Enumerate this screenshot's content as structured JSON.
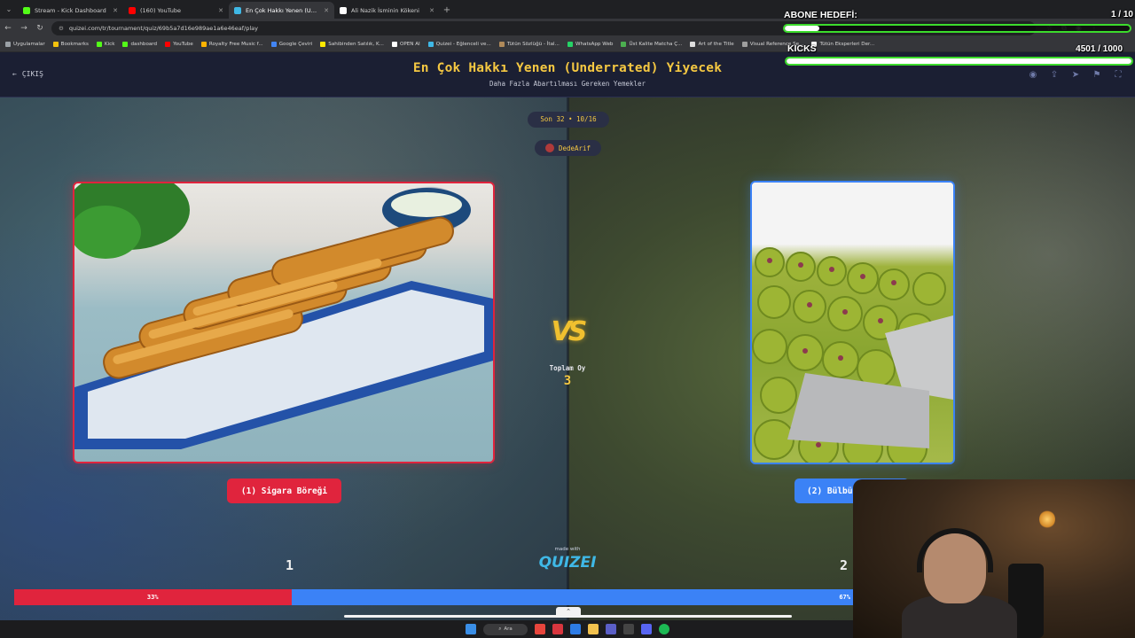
{
  "browser": {
    "tabs": [
      {
        "title": "Stream - Kick Dashboard",
        "favicon_color": "#53fc18",
        "active": false
      },
      {
        "title": "(160) YouTube",
        "favicon_color": "#ff0000",
        "active": false
      },
      {
        "title": "En Çok Hakkı Yenen (Underrated)",
        "favicon_color": "#3fb8e6",
        "active": true
      },
      {
        "title": "Ali Nazik İsminin Kökeni",
        "favicon_color": "#ffffff",
        "active": false
      }
    ],
    "url": "quizei.com/tr/tournament/quiz/69b5a7d16e989ae1a6e46eaf/play",
    "bookmarks": [
      {
        "label": "Uygulamalar",
        "color": "#9aa0a6"
      },
      {
        "label": "Bookmarks",
        "color": "#f4c20d"
      },
      {
        "label": "Kick",
        "color": "#53fc18"
      },
      {
        "label": "dashboard",
        "color": "#53fc18"
      },
      {
        "label": "YouTube",
        "color": "#ff0000"
      },
      {
        "label": "Royalty Free Music f...",
        "color": "#ffb300"
      },
      {
        "label": "Google Çeviri",
        "color": "#4285f4"
      },
      {
        "label": "Sahibinden Satılık, K...",
        "color": "#ffe800"
      },
      {
        "label": "OPEN AI",
        "color": "#ffffff"
      },
      {
        "label": "Quizei - Eğlenceli ve...",
        "color": "#3fb8e6"
      },
      {
        "label": "Tütün Sözlüğü - İtal...",
        "color": "#b08a5a"
      },
      {
        "label": "WhatsApp Web",
        "color": "#25d366"
      },
      {
        "label": "Üst Kalite Matcha Ç...",
        "color": "#4caf50"
      },
      {
        "label": "Art of the Title",
        "color": "#dddddd"
      },
      {
        "label": "Visual Reference Se...",
        "color": "#9e9e9e"
      },
      {
        "label": "Tütün Eksperleri Der...",
        "color": "#ffffff"
      }
    ]
  },
  "header": {
    "exit_label": "ÇIKIŞ",
    "title": "En Çok Hakkı Yenen (Underrated) Yiyecek",
    "subtitle": "Daha Fazla Abartılması Gereken Yemekler"
  },
  "round": "Son 32 • 10/16",
  "user": "DedeArif",
  "vs_text": "VS",
  "total_votes_label": "Toplam Oy",
  "total_votes": "3",
  "left_choice": {
    "label": "(1) Sigara Böreği",
    "votes": "1",
    "percent_label": "33%",
    "percent": 33
  },
  "right_choice": {
    "label": "(2) Bülbü",
    "votes": "2",
    "percent_label": "67%",
    "percent": 67
  },
  "made_with": "made with",
  "brand": "QUIZEI",
  "taskbar": {
    "search_label": "Ara"
  },
  "stream_overlay": {
    "sub_goal": {
      "label": "ABONE HEDEFİ:",
      "count": "1 / 10",
      "progress": 0.1
    },
    "kicks_goal": {
      "label": "KICKS",
      "count": "4501  / 1000",
      "progress": 1.0
    }
  },
  "colors": {
    "left_accent": "#e0243d",
    "right_accent": "#3b82f6",
    "title": "#f5c842",
    "goal_border": "#3cdc2c"
  }
}
